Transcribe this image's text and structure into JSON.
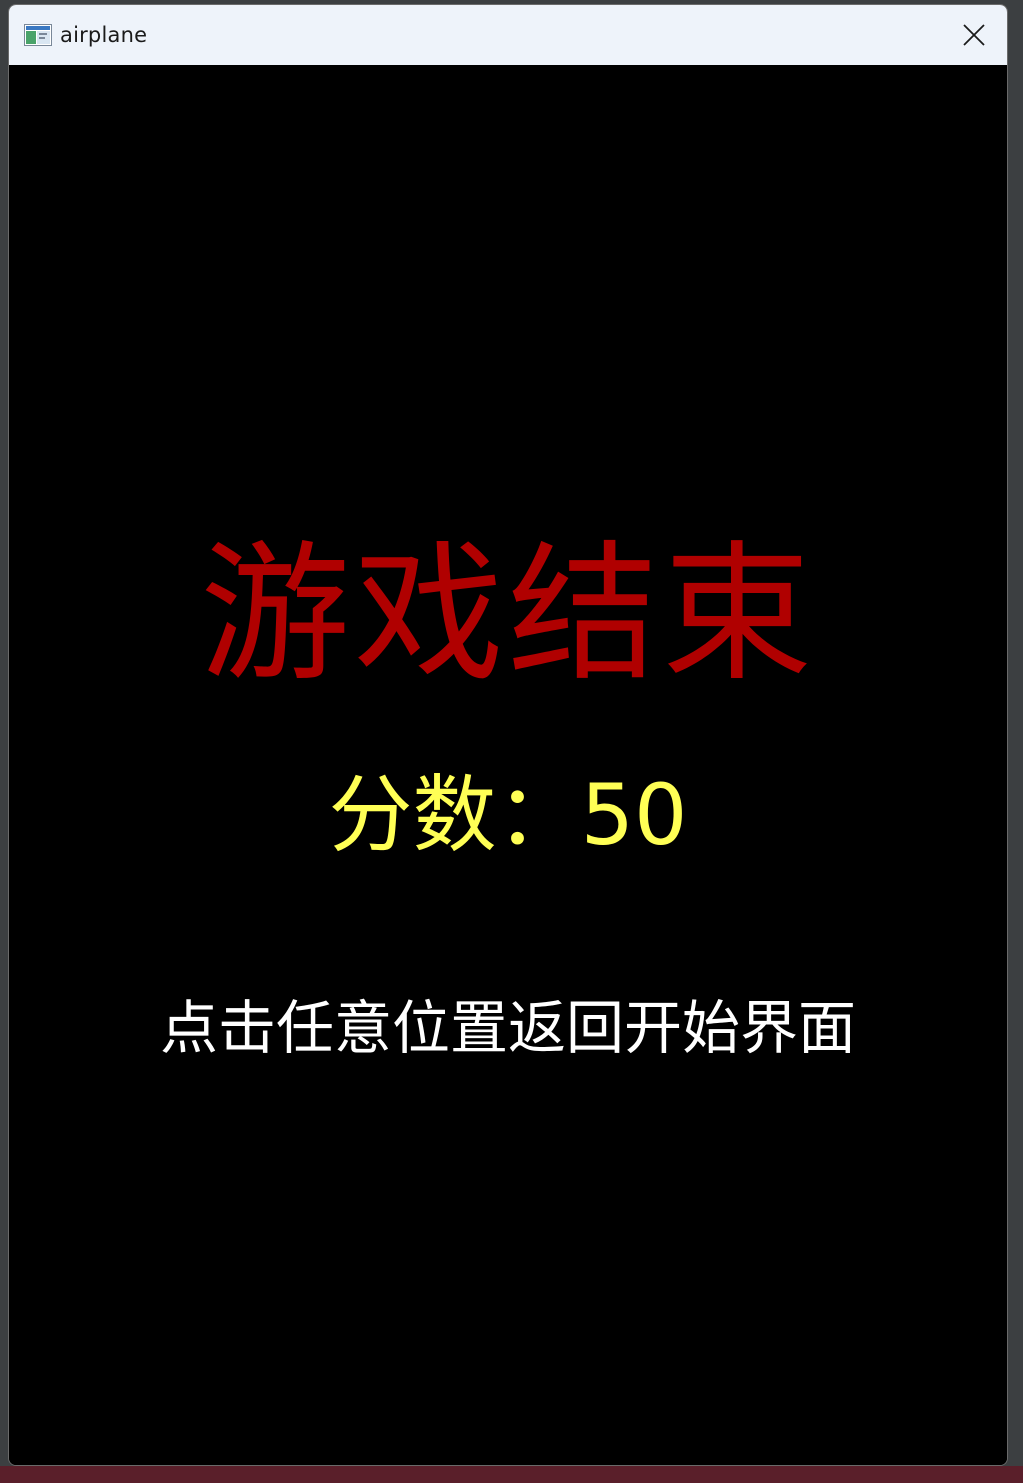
{
  "window": {
    "title": "airplane",
    "app_icon": "window-app-icon",
    "close_icon": "close-icon"
  },
  "game_over": {
    "title": "游戏结束",
    "score_label": "分数：",
    "score_value": "50",
    "hint": "点击任意位置返回开始界面"
  },
  "colors": {
    "title_color": "#b00000",
    "score_color": "#ffff55",
    "hint_color": "#ffffff",
    "background": "#000000"
  }
}
